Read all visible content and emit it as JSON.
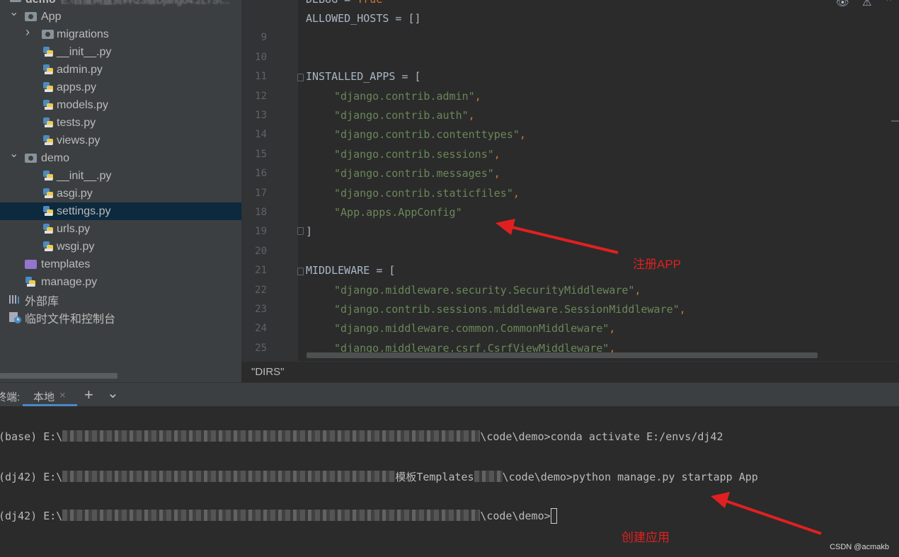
{
  "project_tree": {
    "root_label": "demo",
    "root_path_blurred": "E:\\百度网盘资料\\23版Django4.2LTS\\...",
    "items": [
      {
        "label": "App",
        "kind": "folder",
        "expanded": true
      },
      {
        "label": "migrations",
        "kind": "folder",
        "expanded": false
      },
      {
        "label": "__init__.py",
        "kind": "python"
      },
      {
        "label": "admin.py",
        "kind": "python"
      },
      {
        "label": "apps.py",
        "kind": "python"
      },
      {
        "label": "models.py",
        "kind": "python"
      },
      {
        "label": "tests.py",
        "kind": "python"
      },
      {
        "label": "views.py",
        "kind": "python"
      },
      {
        "label": "demo",
        "kind": "folder",
        "expanded": true
      },
      {
        "label": "__init__.py",
        "kind": "python"
      },
      {
        "label": "asgi.py",
        "kind": "python"
      },
      {
        "label": "settings.py",
        "kind": "python",
        "selected": true
      },
      {
        "label": "urls.py",
        "kind": "python"
      },
      {
        "label": "wsgi.py",
        "kind": "python"
      },
      {
        "label": "templates",
        "kind": "template-folder"
      },
      {
        "label": "manage.py",
        "kind": "python"
      },
      {
        "label": "外部库",
        "kind": "library"
      },
      {
        "label": "临时文件和控制台",
        "kind": "scratches"
      }
    ]
  },
  "editor": {
    "top_partial_line": "DEBUG = True",
    "lines": [
      {
        "n": "",
        "text": "ALLOWED_HOSTS = []"
      },
      {
        "n": "9",
        "text": ""
      },
      {
        "n": "10",
        "text": ""
      },
      {
        "n": "11",
        "text": "INSTALLED_APPS = ["
      },
      {
        "n": "12",
        "text": "\"django.contrib.admin\","
      },
      {
        "n": "13",
        "text": "\"django.contrib.auth\","
      },
      {
        "n": "14",
        "text": "\"django.contrib.contenttypes\","
      },
      {
        "n": "15",
        "text": "\"django.contrib.sessions\","
      },
      {
        "n": "16",
        "text": "\"django.contrib.messages\","
      },
      {
        "n": "17",
        "text": "\"django.contrib.staticfiles\","
      },
      {
        "n": "18",
        "text": "\"App.apps.AppConfig\""
      },
      {
        "n": "19",
        "text": "]"
      },
      {
        "n": "20",
        "text": ""
      },
      {
        "n": "21",
        "text": "MIDDLEWARE = ["
      },
      {
        "n": "22",
        "text": "\"django.middleware.security.SecurityMiddleware\","
      },
      {
        "n": "23",
        "text": "\"django.contrib.sessions.middleware.SessionMiddleware\","
      },
      {
        "n": "24",
        "text": "\"django.middleware.common.CommonMiddleware\","
      },
      {
        "n": "25",
        "text": "\"django.middleware.csrf.CsrfViewMiddleware\","
      }
    ],
    "breadcrumb": "\"DIRS\""
  },
  "terminal": {
    "label": "终端:",
    "tab_local": "本地",
    "tab_close": "×",
    "add_tab": "+",
    "dropdown": "⌄",
    "lines": [
      {
        "prefix": "(base) E:\\",
        "suffix": "\\code\\demo>conda activate E:/envs/dj42"
      },
      {
        "prefix": "(dj42) E:\\",
        "mid": "模板Templates",
        "suffix": "\\code\\demo>python manage.py startapp App"
      },
      {
        "prefix": "(dj42) E:\\",
        "suffix": "\\code\\demo>"
      }
    ]
  },
  "annotations": {
    "register_app": "注册APP",
    "create_app": "创建应用",
    "watermark": "CSDN @acmakb"
  },
  "colors": {
    "string": "#6a8759",
    "keyword": "#cc7832",
    "code": "#a9b7c6",
    "arrow": "#e02020",
    "selection": "#0d293e"
  }
}
